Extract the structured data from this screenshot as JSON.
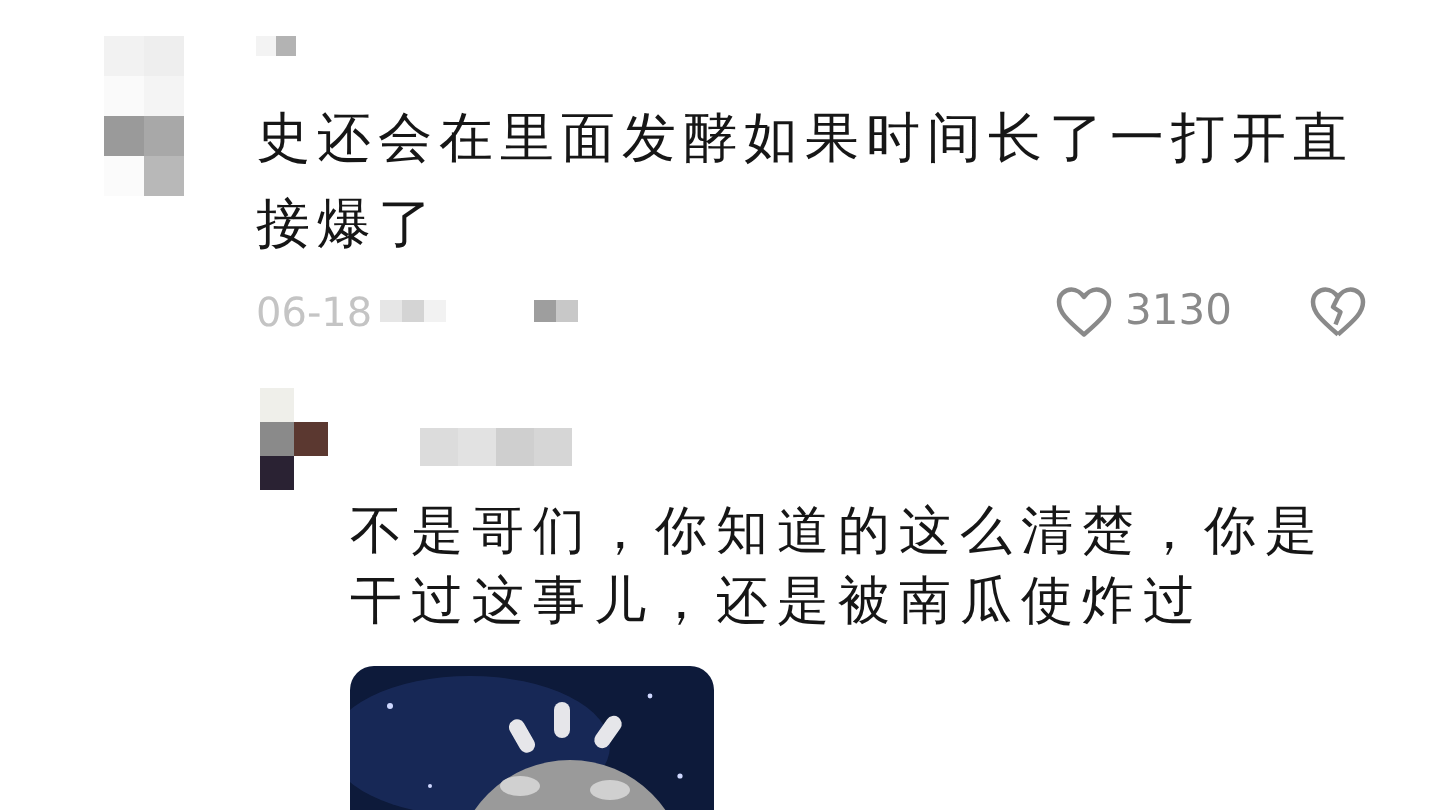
{
  "comment": {
    "text": "史还会在里面发酵如果时间长了一打开直接爆了",
    "date": "06-18",
    "likes": "3130",
    "liked": false,
    "reply": {
      "text": "不是哥们，你知道的这么清楚，你是干过这事儿，还是被南瓜使炸过"
    }
  }
}
